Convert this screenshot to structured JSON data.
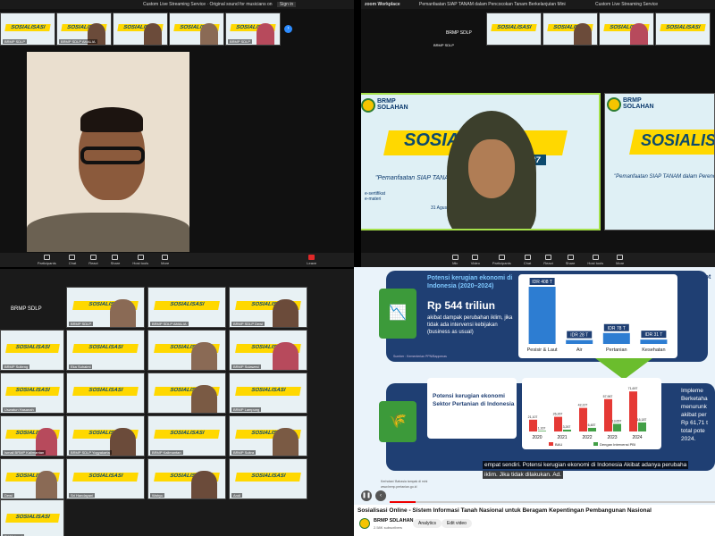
{
  "q1": {
    "tabs": [
      "Custom Live Streaming Service",
      "Original sound for musicians on",
      "Sign in"
    ],
    "main_tag": "BRMP SDLP",
    "toolbar": [
      "Participants",
      "Chat",
      "React",
      "Share",
      "Host tools",
      "More"
    ],
    "leave": "Leave",
    "thumbs": [
      "BRMP SDLP",
      "BRMP SDLP AMALIA",
      "",
      "",
      "BRMP SDLP"
    ]
  },
  "q2": {
    "header": "zoom Workplace",
    "tab": "Pemanfaatan SIAP TANAM dalam Pencocokan Tanam Berkelanjutan Mini",
    "name_tag": "BRMP SDLP",
    "banner": {
      "org": "BRMP SOLAHAN",
      "title": "SOSIALISASI",
      "subtitle": "ONLINE #7",
      "quote": "\"Pemanfaatan SIAP TANAM dalam Perencanaan Tanam",
      "bullets": [
        "e-sertifikat",
        "e-materi"
      ],
      "date": "31 Agustus, 2023"
    },
    "toolbar": [
      "Mic",
      "Video",
      "Participants",
      "Chat",
      "React",
      "Share",
      "Host tools",
      "More"
    ],
    "right_label": "Custom Live Streaming Service"
  },
  "q3": {
    "title": "BRMP SDLP",
    "tiles": [
      "BRMP SDLP",
      "BRMP SDLP AMALIA",
      "BRMP SDLP Dewi",
      "BRMP Sulteng",
      "Eka Suhaimi",
      "",
      "BRMP Sulawesi",
      "Uswatun Hasanah",
      "",
      "",
      "BRMP Lampung",
      "Ismail BRMP Kalimantan",
      "BRMP SDLP Yogyakarta",
      "BRMP Kalimantan",
      "BRMP Sultra",
      "Dewi",
      "Sri Handayani",
      "Wahyu",
      "Andi",
      "Sri Mulyani"
    ]
  },
  "q4": {
    "potensi_right": "Pot",
    "section1": {
      "title": "Potensi kerugian ekonomi di Indonesia (2020–2024)",
      "amount": "Rp 544 triliun",
      "desc": "akibat dampak perubahan iklim, jika tidak ada intervensi kebijakan (business as usual)",
      "source": "Sumber : Kementerian PPN/Bappenas"
    },
    "section2": {
      "title": "Potensi kerugian ekonomi Sektor Pertanian di Indonesia",
      "right_lines": [
        "Impleme",
        "Berketaha",
        "menurunk",
        "akibat per",
        "Rp 61,71 t",
        "total pote",
        "2024."
      ]
    },
    "caption": "empat sendiri. Potensi kerugian ekonomi di Indonesia Akibat adanya perubaha",
    "caption2": "iklim. Jika tidak dilakukan. Ad.",
    "link": "Kerhotan/ Bahasia tampak di mini",
    "link2": "www.brmp.pertanian.go.id",
    "video_title": "Sosialisasi Online - Sistem Informasi Tanah Nasional untuk Beragam Kepentingan Pembangunan Nasional",
    "channel": "BRMP SDLAHAN",
    "subs": "2.58K subscribers",
    "btn_analytics": "Analytics",
    "btn_edit": "Edit video"
  },
  "chart_data": [
    {
      "type": "bar",
      "categories": [
        "Pesisir & Laut",
        "Air",
        "Pertanian",
        "Kesehatan"
      ],
      "values": [
        408,
        28,
        78,
        31
      ],
      "value_labels": [
        "IDR 408 T",
        "IDR 28 T",
        "IDR 78 T",
        "IDR 31 T"
      ],
      "title": "",
      "xlabel": "",
      "ylabel": "",
      "colors": [
        "#2d7dd2",
        "#2d7dd2",
        "#2d7dd2",
        "#2d7dd2"
      ]
    },
    {
      "type": "bar",
      "categories": [
        "2020",
        "2021",
        "2022",
        "2023",
        "2024"
      ],
      "series": [
        {
          "name": "BAU",
          "values": [
            21.107,
            26.267,
            42.227,
            57.967,
            71.697
          ]
        },
        {
          "name": "Dengan Intervensi PBI",
          "values": [
            1.167,
            3.267,
            6.487,
            13.657,
            16.187
          ]
        }
      ],
      "value_labels_bau": [
        "21,107",
        "26,267",
        "42,227",
        "57,967",
        "71,697"
      ],
      "value_labels_pbi": [
        "1,167",
        "3,267",
        "6,487",
        "13,657",
        "16,187"
      ],
      "colors": {
        "BAU": "#e53935",
        "Dengan Intervensi PBI": "#43a047"
      }
    }
  ]
}
